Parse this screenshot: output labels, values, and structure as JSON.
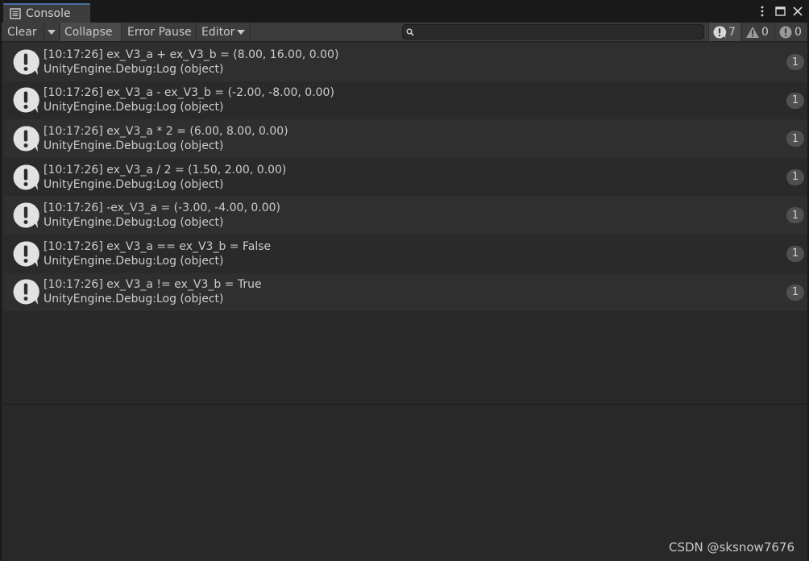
{
  "window": {
    "tab_title": "Console",
    "colors": {
      "accent": "#4a6fa5",
      "background": "#282828",
      "toolbar": "#3c3c3c"
    }
  },
  "toolbar": {
    "clear_label": "Clear",
    "collapse_label": "Collapse",
    "error_pause_label": "Error Pause",
    "editor_label": "Editor",
    "search_placeholder": "",
    "log_count": "7",
    "warning_count": "0",
    "error_count": "0"
  },
  "entries": [
    {
      "line1": "[10:17:26] ex_V3_a + ex_V3_b = (8.00, 16.00, 0.00)",
      "line2": "UnityEngine.Debug:Log (object)",
      "count": "1",
      "icon": "info-icon"
    },
    {
      "line1": "[10:17:26] ex_V3_a - ex_V3_b = (-2.00, -8.00, 0.00)",
      "line2": "UnityEngine.Debug:Log (object)",
      "count": "1",
      "icon": "info-icon"
    },
    {
      "line1": "[10:17:26] ex_V3_a * 2 = (6.00, 8.00, 0.00)",
      "line2": "UnityEngine.Debug:Log (object)",
      "count": "1",
      "icon": "info-icon"
    },
    {
      "line1": "[10:17:26] ex_V3_a / 2 = (1.50, 2.00, 0.00)",
      "line2": "UnityEngine.Debug:Log (object)",
      "count": "1",
      "icon": "info-icon"
    },
    {
      "line1": "[10:17:26] -ex_V3_a = (-3.00, -4.00, 0.00)",
      "line2": "UnityEngine.Debug:Log (object)",
      "count": "1",
      "icon": "info-icon"
    },
    {
      "line1": "[10:17:26] ex_V3_a == ex_V3_b = False",
      "line2": "UnityEngine.Debug:Log (object)",
      "count": "1",
      "icon": "info-icon"
    },
    {
      "line1": "[10:17:26] ex_V3_a != ex_V3_b = True",
      "line2": "UnityEngine.Debug:Log (object)",
      "count": "1",
      "icon": "info-icon"
    }
  ],
  "detail_text": "",
  "watermark": "CSDN @sksnow7676"
}
